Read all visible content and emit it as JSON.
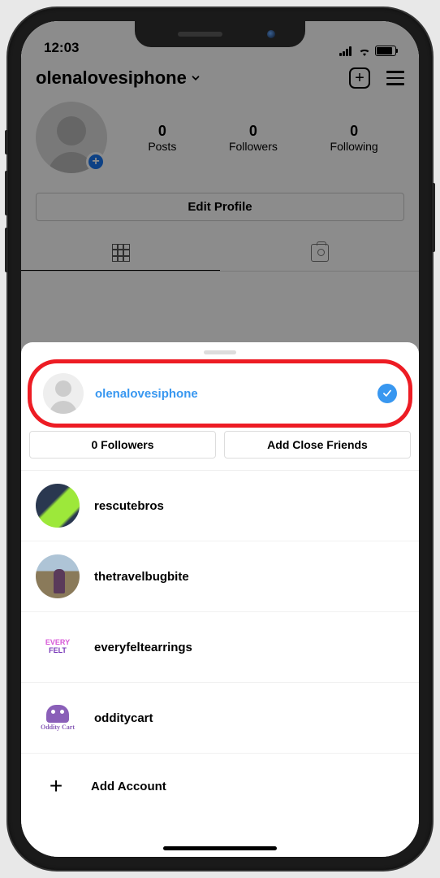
{
  "status": {
    "time": "12:03"
  },
  "profile": {
    "username": "olenalovesiphone",
    "stats": {
      "posts": {
        "count": "0",
        "label": "Posts"
      },
      "followers": {
        "count": "0",
        "label": "Followers"
      },
      "following": {
        "count": "0",
        "label": "Following"
      }
    },
    "edit_button": "Edit Profile"
  },
  "sheet": {
    "selected_account": "olenalovesiphone",
    "quick_actions": {
      "followers": "0 Followers",
      "close_friends": "Add Close Friends"
    },
    "accounts": [
      {
        "username": "rescutebros"
      },
      {
        "username": "thetravelbugbite"
      },
      {
        "username": "everyfeltearrings"
      },
      {
        "username": "odditycart"
      }
    ],
    "add_account": "Add Account"
  },
  "avatar_thumbs": {
    "felt_line1": "EVERY",
    "felt_line2": "FELT",
    "oddity_text": "Oddity Cart"
  }
}
